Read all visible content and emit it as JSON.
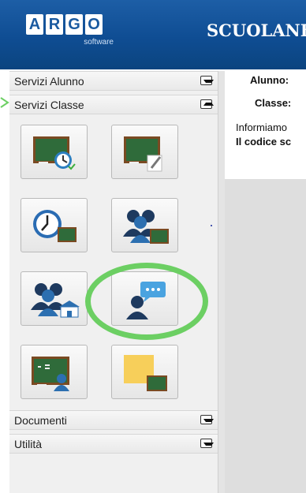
{
  "header": {
    "logo_letters": [
      "A",
      "R",
      "G",
      "O"
    ],
    "logo_sub": "software",
    "brand": "SCUOLANE"
  },
  "sidebar": {
    "sections": [
      {
        "label": "Servizi Alunno",
        "state": "collapsed"
      },
      {
        "label": "Servizi Classe",
        "state": "expanded"
      },
      {
        "label": "Documenti",
        "state": "collapsed"
      },
      {
        "label": "Utilità",
        "state": "collapsed"
      }
    ],
    "tiles": [
      {
        "icon": "blackboard-clock-icon"
      },
      {
        "icon": "blackboard-pencil-icon"
      },
      {
        "icon": "clock-blackboard-icon"
      },
      {
        "icon": "students-blackboard-icon"
      },
      {
        "icon": "students-school-icon"
      },
      {
        "icon": "teacher-chat-icon",
        "highlighted": true
      },
      {
        "icon": "math-blackboard-icon"
      },
      {
        "icon": "note-blackboard-icon"
      }
    ]
  },
  "main": {
    "alunno_label": "Alunno:",
    "classe_label": "Classe:",
    "info_text": "Informiamo",
    "code_text": "Il codice sc"
  },
  "colors": {
    "header": "#0f4d93",
    "highlight": "#6ccf63",
    "blackboard": "#2f6b3a"
  }
}
